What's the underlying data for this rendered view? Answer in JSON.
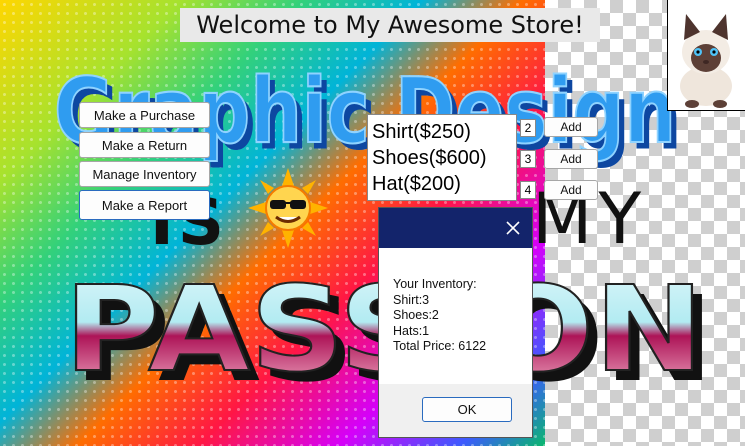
{
  "window": {
    "title": "Welcome to My Awesome Store!"
  },
  "background": {
    "headline": "Graphic Design",
    "is_word": "IS",
    "my_word": "MY",
    "passion_word": "PASSION"
  },
  "menu": {
    "make_purchase": "Make a Purchase",
    "make_return": "Make a Return",
    "manage_inventory": "Manage Inventory",
    "make_report": "Make a Report"
  },
  "products": {
    "items": [
      "Shirt($250)",
      "Shoes($600)",
      "Hat($200)"
    ],
    "quantities": [
      "2",
      "3",
      "4"
    ],
    "add_label": "Add"
  },
  "dialog": {
    "lines": [
      "Your Inventory:",
      "Shirt:3",
      "Shoes:2",
      "Hats:1",
      "Total Price: 6122"
    ],
    "ok_label": "OK"
  },
  "colors": {
    "dialog_titlebar": "#13246b",
    "focus_border": "#2a6bbf",
    "headline_blue": "#2f9cf0"
  }
}
